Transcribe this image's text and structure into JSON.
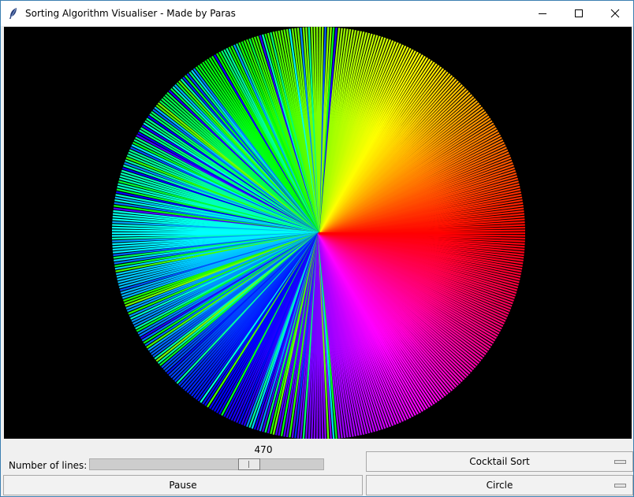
{
  "window": {
    "title": "Sorting Algorithm Visualiser - Made by Paras"
  },
  "canvas": {
    "background": "#000000",
    "line_count": 470
  },
  "controls": {
    "lines_label": "Number of lines:",
    "scale_value": "470",
    "scale_fraction": 0.7,
    "algorithm_option": "Cocktail Sort",
    "pause_label": "Pause",
    "shape_option": "Circle"
  }
}
